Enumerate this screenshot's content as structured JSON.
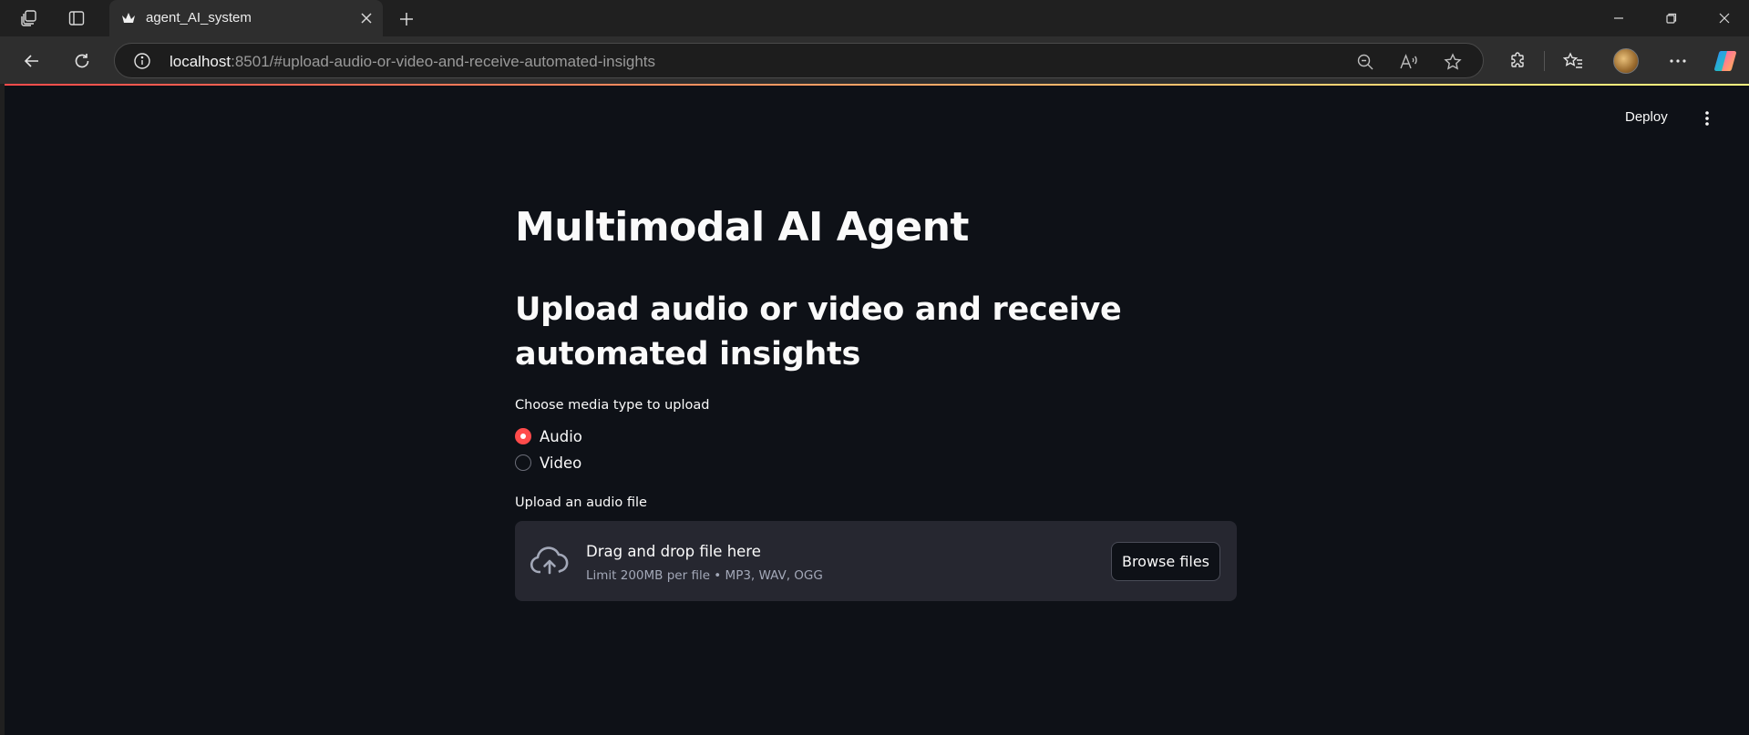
{
  "browser": {
    "tab_title": "agent_AI_system",
    "url_host": "localhost",
    "url_rest": ":8501/#upload-audio-or-video-and-receive-automated-insights",
    "icons": [
      "workspaces-icon",
      "tab-actions-icon",
      "streamlit-favicon",
      "close-icon",
      "plus-icon",
      "minimize-icon",
      "restore-icon",
      "close-window-icon",
      "back-icon",
      "refresh-icon",
      "info-icon",
      "zoom-out-icon",
      "read-aloud-icon",
      "favorite-star-icon",
      "extensions-icon",
      "favorites-icon",
      "profile-avatar",
      "more-icon",
      "copilot-icon"
    ]
  },
  "app": {
    "deploy_label": "Deploy",
    "title": "Multimodal AI Agent",
    "subtitle": "Upload audio or video and receive automated insights",
    "media_type_label": "Choose media type to upload",
    "media_options": [
      {
        "label": "Audio",
        "selected": true
      },
      {
        "label": "Video",
        "selected": false
      }
    ],
    "uploader": {
      "label": "Upload an audio file",
      "drop_title": "Drag and drop file here",
      "drop_limit": "Limit 200MB per file • MP3, WAV, OGG",
      "browse_label": "Browse files"
    },
    "colors": {
      "background": "#0e1117",
      "accent": "#ff4b4b",
      "dropzone": "#262730"
    }
  }
}
